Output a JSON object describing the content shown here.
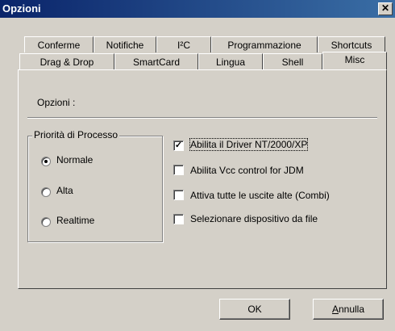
{
  "window": {
    "title": "Opzioni",
    "close": "✕"
  },
  "tabs_row1": [
    {
      "label": "Conferme"
    },
    {
      "label": "Notifiche"
    },
    {
      "label": "I²C"
    },
    {
      "label": "Programmazione"
    },
    {
      "label": "Shortcuts"
    }
  ],
  "tabs_row2": [
    {
      "label": "Drag & Drop"
    },
    {
      "label": "SmartCard"
    },
    {
      "label": "Lingua"
    },
    {
      "label": "Shell"
    },
    {
      "label": "Misc"
    }
  ],
  "active_tab": "Misc",
  "panel": {
    "section_label": "Opzioni :",
    "priority_group": {
      "title": "Priorità di Processo",
      "options": [
        {
          "label": "Normale",
          "selected": true
        },
        {
          "label": "Alta",
          "selected": false
        },
        {
          "label": "Realtime",
          "selected": false
        }
      ]
    },
    "checkboxes": [
      {
        "label": "Abilita il Driver NT/2000/XP",
        "checked": true
      },
      {
        "label": "Abilita Vcc control for JDM",
        "checked": false
      },
      {
        "label": "Attiva tutte le uscite alte (Combi)",
        "checked": false
      },
      {
        "label": "Selezionare dispositivo da file",
        "checked": false
      }
    ]
  },
  "buttons": {
    "ok": "OK",
    "cancel_first": "A",
    "cancel_rest": "nnulla"
  }
}
